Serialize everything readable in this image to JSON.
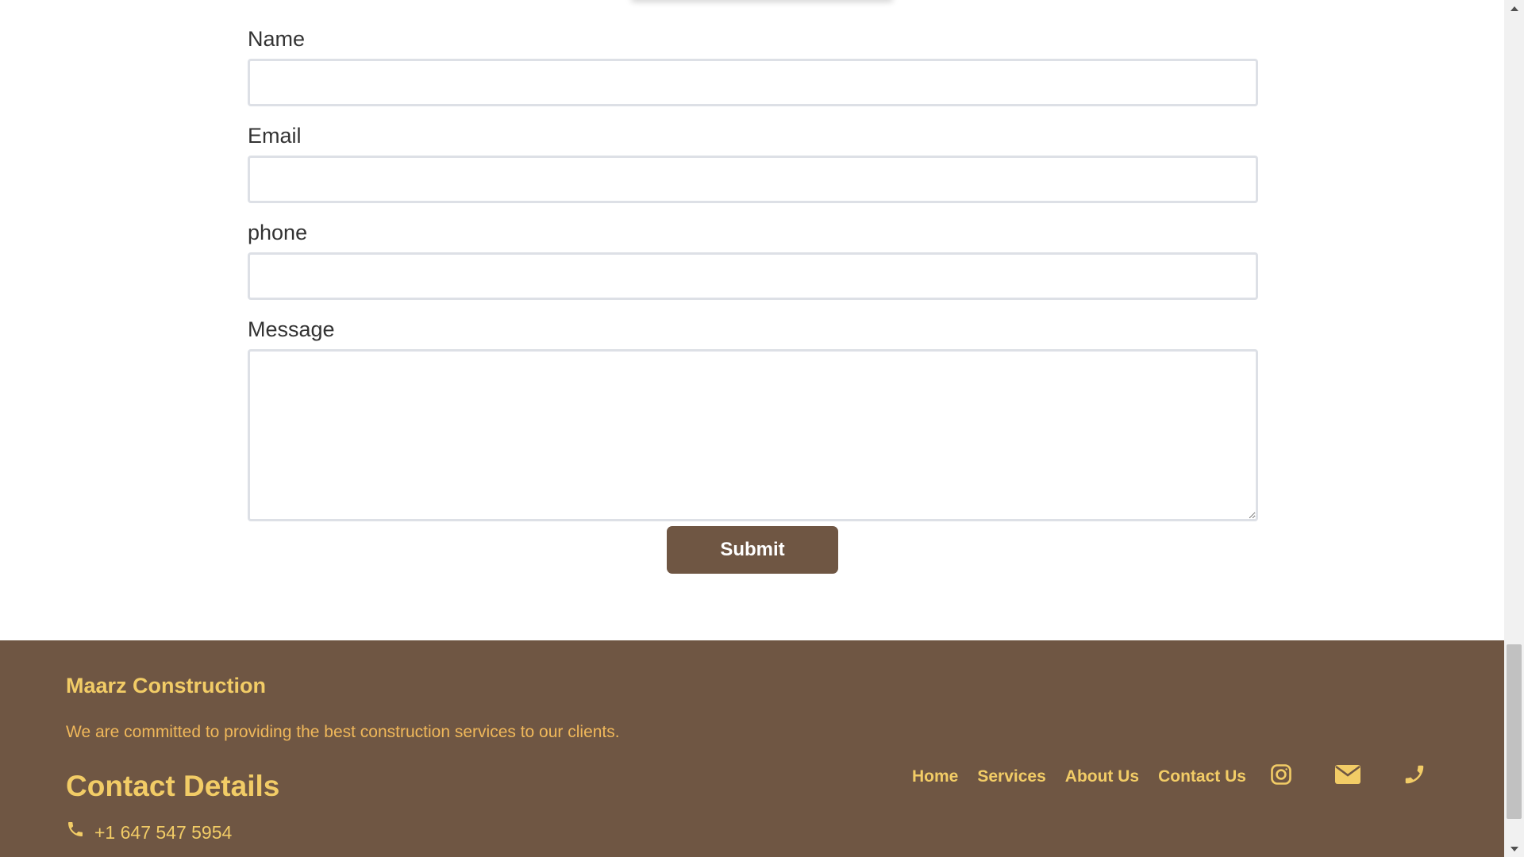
{
  "form": {
    "name_label": "Name",
    "name_value": "",
    "email_label": "Email",
    "email_value": "",
    "phone_label": "phone",
    "phone_value": "",
    "message_label": "Message",
    "message_value": "",
    "submit_label": "Submit"
  },
  "footer": {
    "brand": "Maarz Construction",
    "tagline": "We are committed to providing the best construction services to our clients.",
    "contact_heading": "Contact Details",
    "phone": "+1 647 547 5954",
    "nav": [
      {
        "label": "Home"
      },
      {
        "label": "Services"
      },
      {
        "label": "About Us"
      },
      {
        "label": "Contact Us"
      }
    ],
    "social_icons": [
      "instagram-icon",
      "envelope-icon",
      "phone-icon"
    ]
  },
  "colors": {
    "brand_brown": "#6f5643",
    "accent_gold": "#f2cc66",
    "tagline_orange": "#f0b85a",
    "input_border": "#dde0e6"
  }
}
